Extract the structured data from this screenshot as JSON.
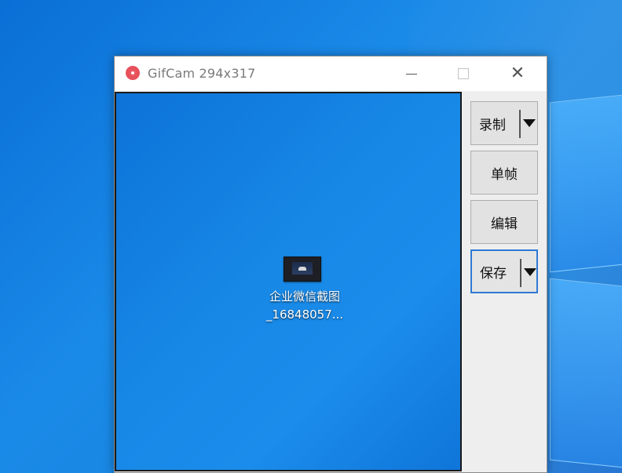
{
  "window": {
    "title": "GifCam 294x317",
    "app_icon": "gifcam-icon",
    "accent_color": "#e8505b",
    "caption_buttons": {
      "minimize_icon": "minimize-icon",
      "maximize_icon": "maximize-icon",
      "close_icon": "close-icon",
      "close_glyph": "✕"
    }
  },
  "capture_area": {
    "desktop_icon": {
      "icon": "image-file-icon",
      "label_line1": "企业微信截图",
      "label_line2": "_16848057..."
    }
  },
  "side_buttons": {
    "record": "录制",
    "frame": "单帧",
    "edit": "编辑",
    "save": "保存"
  },
  "colors": {
    "desktop_blue": "#1788e6",
    "focus_border": "#2f79d6"
  }
}
